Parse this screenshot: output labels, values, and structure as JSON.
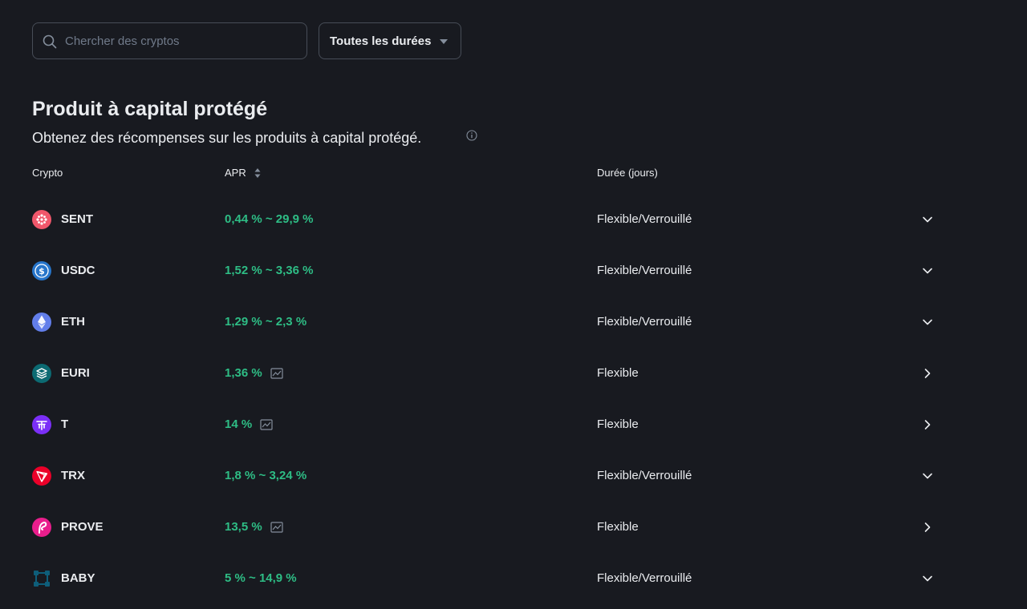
{
  "search": {
    "placeholder": "Chercher des cryptos",
    "value": ""
  },
  "duration_filter": {
    "selected": "Toutes les durées"
  },
  "section": {
    "title": "Produit à capital protégé",
    "subtitle": "Obtenez des récompenses sur les produits à capital protégé."
  },
  "table": {
    "headers": {
      "crypto": "Crypto",
      "apr": "APR",
      "duration": "Durée (jours)"
    },
    "rows": [
      {
        "symbol": "SENT",
        "apr": "0,44 % ~ 29,9 %",
        "duration": "Flexible/Verrouillé",
        "has_chart": false,
        "action": "expand",
        "icon": "sent-icon",
        "color": "#f0576b"
      },
      {
        "symbol": "USDC",
        "apr": "1,52 % ~ 3,36 %",
        "duration": "Flexible/Verrouillé",
        "has_chart": false,
        "action": "expand",
        "icon": "usdc-icon",
        "color": "#2775ca"
      },
      {
        "symbol": "ETH",
        "apr": "1,29 % ~ 2,3 %",
        "duration": "Flexible/Verrouillé",
        "has_chart": false,
        "action": "expand",
        "icon": "eth-icon",
        "color": "#627eea"
      },
      {
        "symbol": "EURI",
        "apr": "1,36 %",
        "duration": "Flexible",
        "has_chart": true,
        "action": "navigate",
        "icon": "euri-icon",
        "color": "#0c6a72"
      },
      {
        "symbol": "T",
        "apr": "14 %",
        "duration": "Flexible",
        "has_chart": true,
        "action": "navigate",
        "icon": "t-icon",
        "color": "#7b2ff7"
      },
      {
        "symbol": "TRX",
        "apr": "1,8 % ~ 3,24 %",
        "duration": "Flexible/Verrouillé",
        "has_chart": false,
        "action": "expand",
        "icon": "trx-icon",
        "color": "#eb0029"
      },
      {
        "symbol": "PROVE",
        "apr": "13,5 %",
        "duration": "Flexible",
        "has_chart": true,
        "action": "navigate",
        "icon": "prove-icon",
        "color": "#e91e8c"
      },
      {
        "symbol": "BABY",
        "apr": "5 % ~ 14,9 %",
        "duration": "Flexible/Verrouillé",
        "has_chart": false,
        "action": "expand",
        "icon": "baby-icon",
        "color": "#0e5e7a"
      }
    ]
  },
  "colors": {
    "background": "#181a20",
    "text": "#eaecef",
    "apr_green": "#2ebd85",
    "border": "#474d57",
    "muted": "#848e9c"
  }
}
